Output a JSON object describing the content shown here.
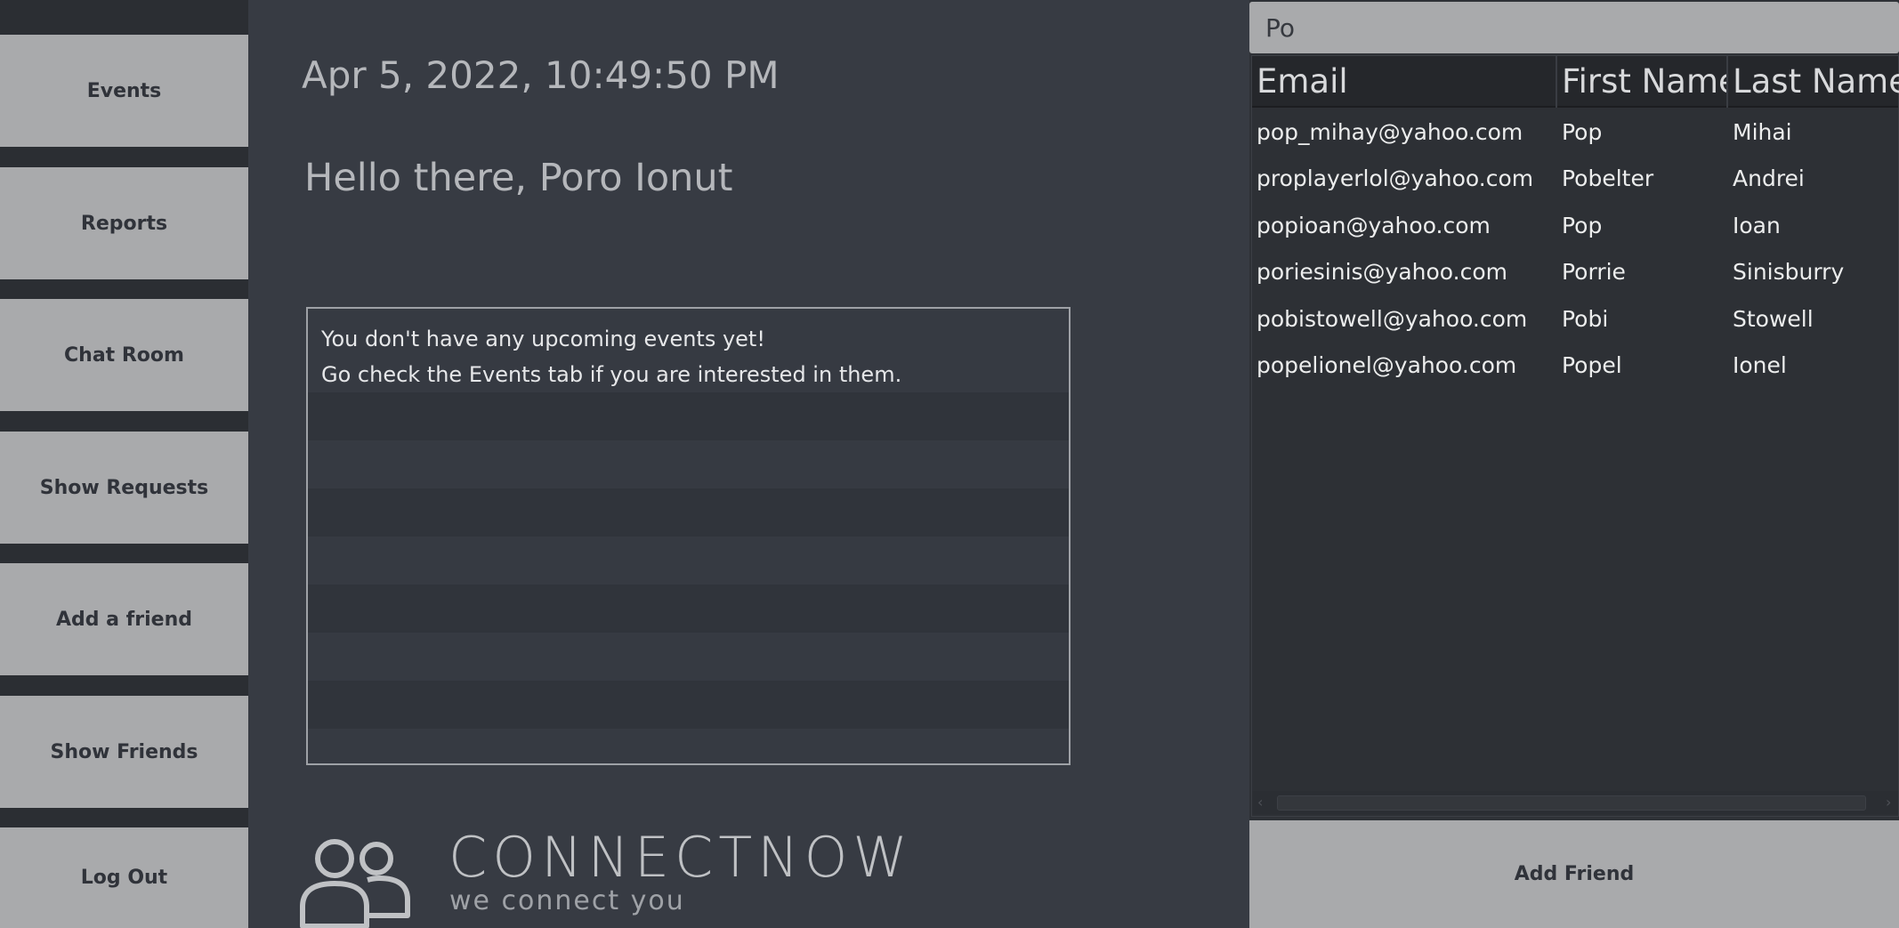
{
  "sidebar": {
    "items": [
      {
        "label": "Events"
      },
      {
        "label": "Reports"
      },
      {
        "label": "Chat Room"
      },
      {
        "label": "Show Requests"
      },
      {
        "label": "Add a friend"
      },
      {
        "label": "Show Friends"
      },
      {
        "label": "Log Out"
      }
    ]
  },
  "main": {
    "datetime": "Apr 5, 2022, 10:49:50 PM",
    "greeting": "Hello there, Poro Ionut",
    "events_empty_line1": "You don't have any upcoming events yet!",
    "events_empty_line2": "Go check the Events tab if you are interested in them."
  },
  "logo": {
    "title": "CONNECTNOW",
    "subtitle": "we connect you"
  },
  "search": {
    "value": "Po"
  },
  "table": {
    "columns": [
      "Email",
      "First Name",
      "Last Name"
    ],
    "rows": [
      [
        "pop_mihay@yahoo.com",
        "Pop",
        "Mihai"
      ],
      [
        "proplayerlol@yahoo.com",
        "Pobelter",
        "Andrei"
      ],
      [
        "popioan@yahoo.com",
        "Pop",
        "Ioan"
      ],
      [
        "poriesinis@yahoo.com",
        "Porrie",
        "Sinisburry"
      ],
      [
        "pobistowell@yahoo.com",
        "Pobi",
        "Stowell"
      ],
      [
        "popelionel@yahoo.com",
        "Popel",
        "Ionel"
      ]
    ]
  },
  "actions": {
    "add_friend_label": "Add Friend"
  }
}
